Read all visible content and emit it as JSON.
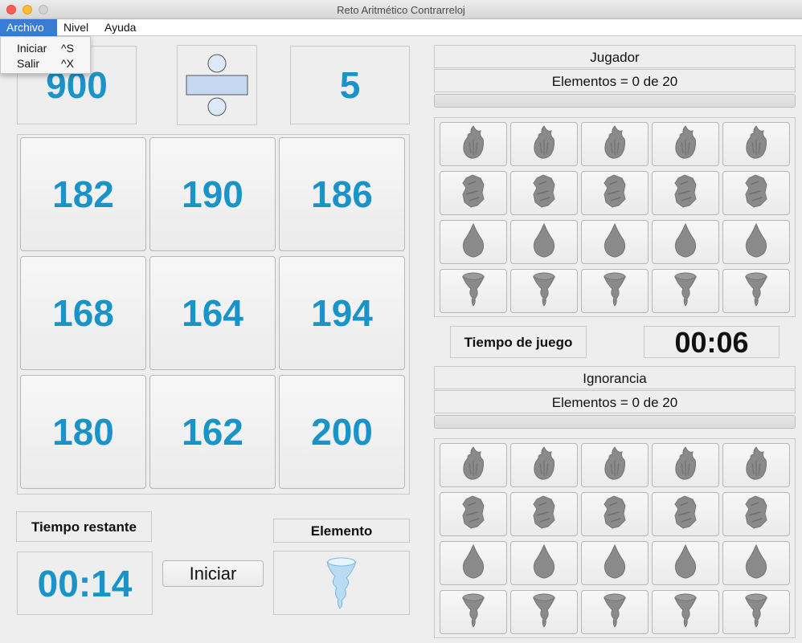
{
  "window": {
    "title": "Reto Aritmético Contrarreloj"
  },
  "menubar": {
    "items": [
      "Archivo",
      "Nivel",
      "Ayuda"
    ],
    "open_menu": {
      "items": [
        {
          "label": "Iniciar",
          "shortcut": "^S"
        },
        {
          "label": "Salir",
          "shortcut": "^X"
        }
      ]
    }
  },
  "problem": {
    "operand1": "900",
    "operator": "division-icon",
    "operand2": "5"
  },
  "answers": [
    "182",
    "190",
    "186",
    "168",
    "164",
    "194",
    "180",
    "162",
    "200"
  ],
  "bottom": {
    "time_label": "Tiempo restante",
    "time_value": "00:14",
    "start_button": "Iniciar",
    "element_label": "Elemento",
    "element_icon": "tornado-icon"
  },
  "player": {
    "name": "Jugador",
    "elements": "Elementos = 0 de 20",
    "progress": 0
  },
  "game_time": {
    "label": "Tiempo de juego",
    "value": "00:06"
  },
  "ignorance": {
    "name": "Ignorancia",
    "elements": "Elementos = 0 de 20",
    "progress": 0
  },
  "element_rows": [
    "fire-icon",
    "earth-icon",
    "water-icon",
    "tornado-icon"
  ],
  "colors": {
    "number_blue": "#1a94c8",
    "menu_highlight": "#3a7bd5",
    "icon_gray": "#8a8a8a"
  }
}
